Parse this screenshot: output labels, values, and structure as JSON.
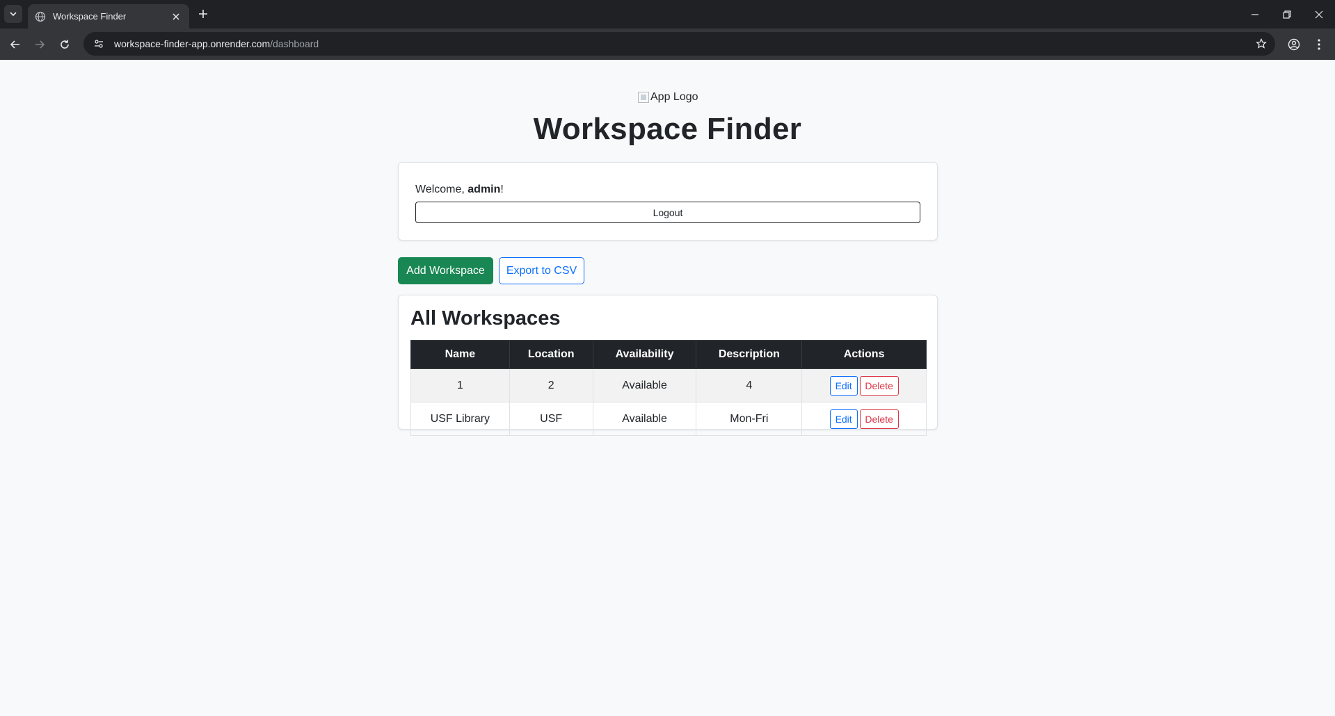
{
  "browser": {
    "tab_title": "Workspace Finder",
    "url_host": "workspace-finder-app.onrender.com",
    "url_path": "/dashboard"
  },
  "header": {
    "logo_alt": "App Logo",
    "title": "Workspace Finder"
  },
  "welcome": {
    "prefix": "Welcome, ",
    "username": "admin",
    "suffix": "!",
    "logout_label": "Logout"
  },
  "actions": {
    "add_label": "Add Workspace",
    "export_label": "Export to CSV"
  },
  "workspaces": {
    "title": "All Workspaces",
    "columns": [
      "Name",
      "Location",
      "Availability",
      "Description",
      "Actions"
    ],
    "rows": [
      {
        "name": "1",
        "location": "2",
        "availability": "Available",
        "description": "4",
        "edit_label": "Edit",
        "delete_label": "Delete"
      },
      {
        "name": "USF Library",
        "location": "USF",
        "availability": "Available",
        "description": "Mon-Fri",
        "edit_label": "Edit",
        "delete_label": "Delete"
      }
    ]
  },
  "colors": {
    "primary": "#0d6efd",
    "success": "#198754",
    "danger": "#dc3545",
    "table_header": "#212529"
  }
}
